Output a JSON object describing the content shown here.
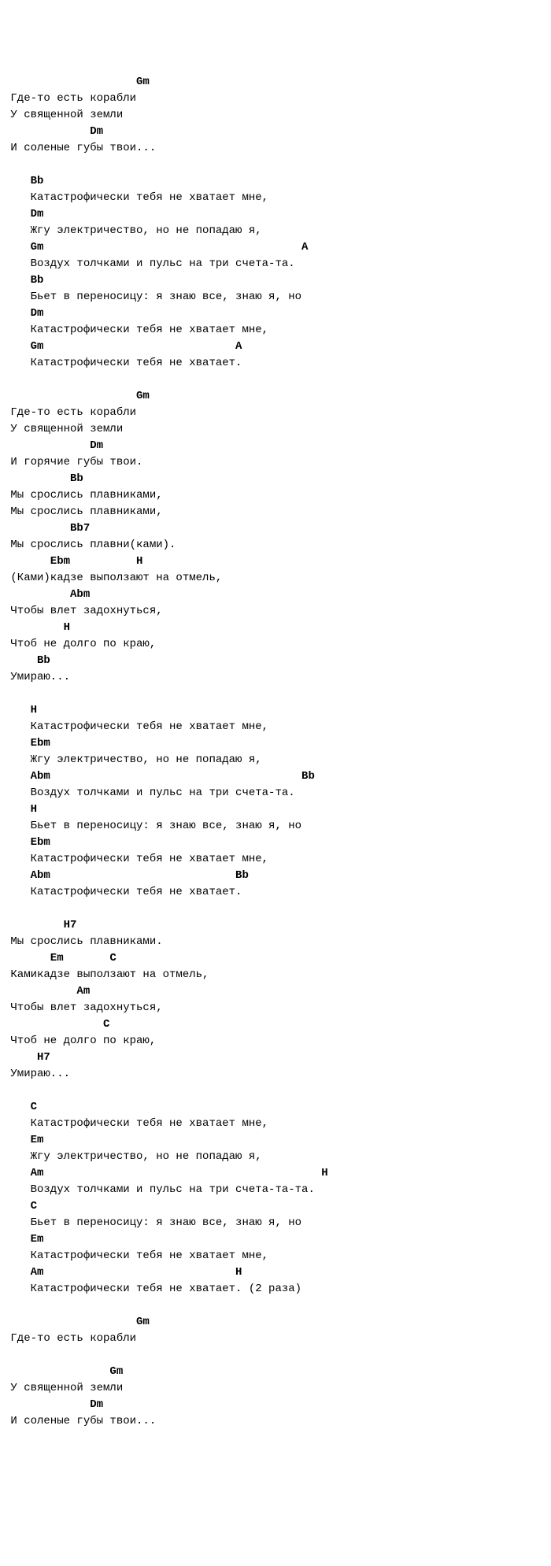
{
  "lines": [
    {
      "type": "chord",
      "text": "                    Gm"
    },
    {
      "type": "lyric",
      "text": " Где-то есть корабли"
    },
    {
      "type": "lyric",
      "text": " У священной земли"
    },
    {
      "type": "chord",
      "text": "             Dm"
    },
    {
      "type": "lyric",
      "text": " И соленые губы твои..."
    },
    {
      "type": "blank",
      "text": ""
    },
    {
      "type": "chord",
      "text": "    Bb"
    },
    {
      "type": "lyric",
      "text": "    Катастрофически тебя не хватает мне,"
    },
    {
      "type": "chord",
      "text": "    Dm"
    },
    {
      "type": "lyric",
      "text": "    Жгу электричество, но не попадаю я,"
    },
    {
      "type": "chord",
      "text": "    Gm                                       A"
    },
    {
      "type": "lyric",
      "text": "    Воздух толчками и пульс на три счета-та."
    },
    {
      "type": "chord",
      "text": "    Bb"
    },
    {
      "type": "lyric",
      "text": "    Бьет в переносицу: я знаю все, знаю я, но"
    },
    {
      "type": "chord",
      "text": "    Dm"
    },
    {
      "type": "lyric",
      "text": "    Катастрофически тебя не хватает мне,"
    },
    {
      "type": "chord",
      "text": "    Gm                             A"
    },
    {
      "type": "lyric",
      "text": "    Катастрофически тебя не хватает."
    },
    {
      "type": "blank",
      "text": ""
    },
    {
      "type": "chord",
      "text": "                    Gm"
    },
    {
      "type": "lyric",
      "text": " Где-то есть корабли"
    },
    {
      "type": "lyric",
      "text": " У священной земли"
    },
    {
      "type": "chord",
      "text": "             Dm"
    },
    {
      "type": "lyric",
      "text": " И горячие губы твои."
    },
    {
      "type": "chord",
      "text": "          Bb"
    },
    {
      "type": "lyric",
      "text": " Мы срослись плавниками,"
    },
    {
      "type": "lyric",
      "text": " Мы срослись плавниками,"
    },
    {
      "type": "chord",
      "text": "          Bb7"
    },
    {
      "type": "lyric",
      "text": " Мы срослись плавни(ками)."
    },
    {
      "type": "chord",
      "text": "       Ebm          H"
    },
    {
      "type": "lyric",
      "text": " (Ками)кадзе выползают на отмель,"
    },
    {
      "type": "chord",
      "text": "          Abm"
    },
    {
      "type": "lyric",
      "text": " Чтобы влет задохнуться,"
    },
    {
      "type": "chord",
      "text": "         H"
    },
    {
      "type": "lyric",
      "text": " Чтоб не долго по краю,"
    },
    {
      "type": "chord",
      "text": "     Bb"
    },
    {
      "type": "lyric",
      "text": " Умираю..."
    },
    {
      "type": "blank",
      "text": ""
    },
    {
      "type": "chord",
      "text": "    H"
    },
    {
      "type": "lyric",
      "text": "    Катастрофически тебя не хватает мне,"
    },
    {
      "type": "chord",
      "text": "    Ebm"
    },
    {
      "type": "lyric",
      "text": "    Жгу электричество, но не попадаю я,"
    },
    {
      "type": "chord",
      "text": "    Abm                                      Bb"
    },
    {
      "type": "lyric",
      "text": "    Воздух толчками и пульс на три счета-та."
    },
    {
      "type": "chord",
      "text": "    H"
    },
    {
      "type": "lyric",
      "text": "    Бьет в переносицу: я знаю все, знаю я, но"
    },
    {
      "type": "chord",
      "text": "    Ebm"
    },
    {
      "type": "lyric",
      "text": "    Катастрофически тебя не хватает мне,"
    },
    {
      "type": "chord",
      "text": "    Abm                            Bb"
    },
    {
      "type": "lyric",
      "text": "    Катастрофически тебя не хватает."
    },
    {
      "type": "blank",
      "text": ""
    },
    {
      "type": "chord",
      "text": "         H7"
    },
    {
      "type": "lyric",
      "text": " Мы срослись плавниками."
    },
    {
      "type": "chord",
      "text": "       Em       C"
    },
    {
      "type": "lyric",
      "text": " Камикадзе выползают на отмель,"
    },
    {
      "type": "chord",
      "text": "           Am"
    },
    {
      "type": "lyric",
      "text": " Чтобы влет задохнуться,"
    },
    {
      "type": "chord",
      "text": "               C"
    },
    {
      "type": "lyric",
      "text": " Чтоб не долго по краю,"
    },
    {
      "type": "chord",
      "text": "     H7"
    },
    {
      "type": "lyric",
      "text": " Умираю..."
    },
    {
      "type": "blank",
      "text": ""
    },
    {
      "type": "chord",
      "text": "    C"
    },
    {
      "type": "lyric",
      "text": "    Катастрофически тебя не хватает мне,"
    },
    {
      "type": "chord",
      "text": "    Em"
    },
    {
      "type": "lyric",
      "text": "    Жгу электричество, но не попадаю я,"
    },
    {
      "type": "chord",
      "text": "    Am                                          H"
    },
    {
      "type": "lyric",
      "text": "    Воздух толчками и пульс на три счета-та-та."
    },
    {
      "type": "chord",
      "text": "    C"
    },
    {
      "type": "lyric",
      "text": "    Бьет в переносицу: я знаю все, знаю я, но"
    },
    {
      "type": "chord",
      "text": "    Em"
    },
    {
      "type": "lyric",
      "text": "    Катастрофически тебя не хватает мне,"
    },
    {
      "type": "chord",
      "text": "    Am                             H"
    },
    {
      "type": "lyric",
      "text": "    Катастрофически тебя не хватает. (2 раза)"
    },
    {
      "type": "blank",
      "text": ""
    },
    {
      "type": "chord",
      "text": "                    Gm"
    },
    {
      "type": "lyric",
      "text": " Где-то есть корабли"
    },
    {
      "type": "blank",
      "text": ""
    },
    {
      "type": "chord",
      "text": "                Gm"
    },
    {
      "type": "lyric",
      "text": " У священной земли"
    },
    {
      "type": "chord",
      "text": "             Dm"
    },
    {
      "type": "lyric",
      "text": " И соленые губы твои..."
    }
  ]
}
